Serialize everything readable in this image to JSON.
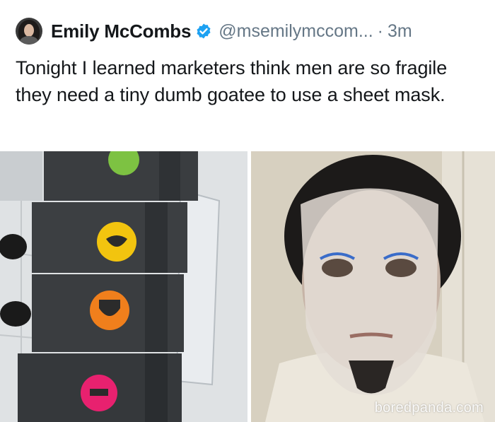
{
  "tweet": {
    "author_name": "Emily McCombs",
    "verified_icon": "verified-badge-icon",
    "handle": "@msemilymccom...",
    "separator": "·",
    "timestamp": "3m",
    "text": "Tonight I learned marketers think men are so fragile they need a tiny dumb goatee to use a sheet mask."
  },
  "photos": {
    "left": {
      "icon": "sheet-mask-packets-photo"
    },
    "right": {
      "icon": "selfie-with-sheet-mask-photo",
      "watermark": "boredpanda.com"
    }
  },
  "colors": {
    "text": "#14171a",
    "secondary_text": "#657786",
    "verified_blue": "#1da1f2",
    "packet_green": "#7dc242",
    "packet_yellow": "#f2c40f",
    "packet_orange": "#f07f1c",
    "packet_pink": "#e8216f"
  }
}
